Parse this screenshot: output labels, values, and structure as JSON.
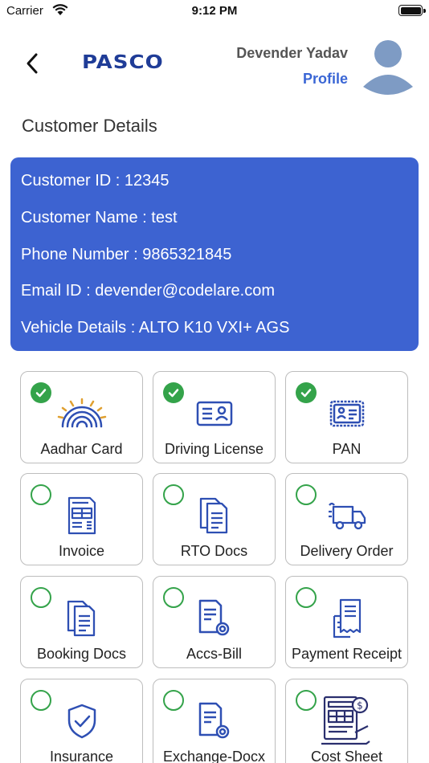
{
  "status_bar": {
    "carrier": "Carrier",
    "time": "9:12 PM"
  },
  "header": {
    "logo": "PASCO",
    "user_name": "Devender Yadav",
    "profile_label": "Profile"
  },
  "section_title": "Customer Details",
  "customer": {
    "lines": [
      "Customer ID : 12345",
      "Customer Name : test",
      "Phone Number : 9865321845",
      "Email ID : devender@codelare.com",
      "Vehicle Details : ALTO K10 VXI+ AGS"
    ]
  },
  "documents": [
    {
      "label": "Aadhar Card",
      "uploaded": true,
      "icon": "aadhar-icon"
    },
    {
      "label": "Driving License",
      "uploaded": true,
      "icon": "id-card-icon"
    },
    {
      "label": "PAN",
      "uploaded": true,
      "icon": "pan-card-icon"
    },
    {
      "label": "Invoice",
      "uploaded": false,
      "icon": "invoice-icon"
    },
    {
      "label": "RTO Docs",
      "uploaded": false,
      "icon": "documents-icon"
    },
    {
      "label": "Delivery Order",
      "uploaded": false,
      "icon": "delivery-truck-icon"
    },
    {
      "label": "Booking Docs",
      "uploaded": false,
      "icon": "documents-icon"
    },
    {
      "label": "Accs-Bill",
      "uploaded": false,
      "icon": "bill-search-icon"
    },
    {
      "label": "Payment Receipt",
      "uploaded": false,
      "icon": "receipt-icon"
    },
    {
      "label": "Insurance",
      "uploaded": false,
      "icon": "shield-check-icon"
    },
    {
      "label": "Exchange-Docx",
      "uploaded": false,
      "icon": "bill-search-icon"
    },
    {
      "label": "Cost Sheet",
      "uploaded": false,
      "icon": "cost-sheet-icon"
    }
  ],
  "colors": {
    "brand": "#1f3c97",
    "card_background": "#3d63d1",
    "link": "#3a66d5",
    "check": "#34a34a",
    "icon": "#2e4fb3"
  }
}
